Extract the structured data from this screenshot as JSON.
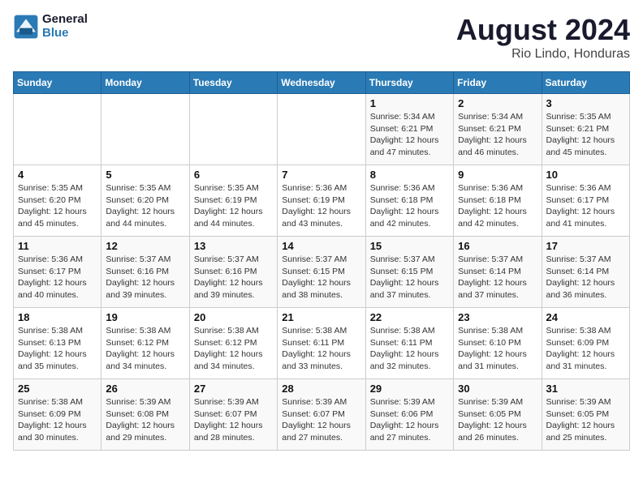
{
  "logo": {
    "text_general": "General",
    "text_blue": "Blue"
  },
  "header": {
    "title": "August 2024",
    "subtitle": "Rio Lindo, Honduras"
  },
  "weekdays": [
    "Sunday",
    "Monday",
    "Tuesday",
    "Wednesday",
    "Thursday",
    "Friday",
    "Saturday"
  ],
  "weeks": [
    [
      {
        "day": "",
        "info": ""
      },
      {
        "day": "",
        "info": ""
      },
      {
        "day": "",
        "info": ""
      },
      {
        "day": "",
        "info": ""
      },
      {
        "day": "1",
        "info": "Sunrise: 5:34 AM\nSunset: 6:21 PM\nDaylight: 12 hours\nand 47 minutes."
      },
      {
        "day": "2",
        "info": "Sunrise: 5:34 AM\nSunset: 6:21 PM\nDaylight: 12 hours\nand 46 minutes."
      },
      {
        "day": "3",
        "info": "Sunrise: 5:35 AM\nSunset: 6:21 PM\nDaylight: 12 hours\nand 45 minutes."
      }
    ],
    [
      {
        "day": "4",
        "info": "Sunrise: 5:35 AM\nSunset: 6:20 PM\nDaylight: 12 hours\nand 45 minutes."
      },
      {
        "day": "5",
        "info": "Sunrise: 5:35 AM\nSunset: 6:20 PM\nDaylight: 12 hours\nand 44 minutes."
      },
      {
        "day": "6",
        "info": "Sunrise: 5:35 AM\nSunset: 6:19 PM\nDaylight: 12 hours\nand 44 minutes."
      },
      {
        "day": "7",
        "info": "Sunrise: 5:36 AM\nSunset: 6:19 PM\nDaylight: 12 hours\nand 43 minutes."
      },
      {
        "day": "8",
        "info": "Sunrise: 5:36 AM\nSunset: 6:18 PM\nDaylight: 12 hours\nand 42 minutes."
      },
      {
        "day": "9",
        "info": "Sunrise: 5:36 AM\nSunset: 6:18 PM\nDaylight: 12 hours\nand 42 minutes."
      },
      {
        "day": "10",
        "info": "Sunrise: 5:36 AM\nSunset: 6:17 PM\nDaylight: 12 hours\nand 41 minutes."
      }
    ],
    [
      {
        "day": "11",
        "info": "Sunrise: 5:36 AM\nSunset: 6:17 PM\nDaylight: 12 hours\nand 40 minutes."
      },
      {
        "day": "12",
        "info": "Sunrise: 5:37 AM\nSunset: 6:16 PM\nDaylight: 12 hours\nand 39 minutes."
      },
      {
        "day": "13",
        "info": "Sunrise: 5:37 AM\nSunset: 6:16 PM\nDaylight: 12 hours\nand 39 minutes."
      },
      {
        "day": "14",
        "info": "Sunrise: 5:37 AM\nSunset: 6:15 PM\nDaylight: 12 hours\nand 38 minutes."
      },
      {
        "day": "15",
        "info": "Sunrise: 5:37 AM\nSunset: 6:15 PM\nDaylight: 12 hours\nand 37 minutes."
      },
      {
        "day": "16",
        "info": "Sunrise: 5:37 AM\nSunset: 6:14 PM\nDaylight: 12 hours\nand 37 minutes."
      },
      {
        "day": "17",
        "info": "Sunrise: 5:37 AM\nSunset: 6:14 PM\nDaylight: 12 hours\nand 36 minutes."
      }
    ],
    [
      {
        "day": "18",
        "info": "Sunrise: 5:38 AM\nSunset: 6:13 PM\nDaylight: 12 hours\nand 35 minutes."
      },
      {
        "day": "19",
        "info": "Sunrise: 5:38 AM\nSunset: 6:12 PM\nDaylight: 12 hours\nand 34 minutes."
      },
      {
        "day": "20",
        "info": "Sunrise: 5:38 AM\nSunset: 6:12 PM\nDaylight: 12 hours\nand 34 minutes."
      },
      {
        "day": "21",
        "info": "Sunrise: 5:38 AM\nSunset: 6:11 PM\nDaylight: 12 hours\nand 33 minutes."
      },
      {
        "day": "22",
        "info": "Sunrise: 5:38 AM\nSunset: 6:11 PM\nDaylight: 12 hours\nand 32 minutes."
      },
      {
        "day": "23",
        "info": "Sunrise: 5:38 AM\nSunset: 6:10 PM\nDaylight: 12 hours\nand 31 minutes."
      },
      {
        "day": "24",
        "info": "Sunrise: 5:38 AM\nSunset: 6:09 PM\nDaylight: 12 hours\nand 31 minutes."
      }
    ],
    [
      {
        "day": "25",
        "info": "Sunrise: 5:38 AM\nSunset: 6:09 PM\nDaylight: 12 hours\nand 30 minutes."
      },
      {
        "day": "26",
        "info": "Sunrise: 5:39 AM\nSunset: 6:08 PM\nDaylight: 12 hours\nand 29 minutes."
      },
      {
        "day": "27",
        "info": "Sunrise: 5:39 AM\nSunset: 6:07 PM\nDaylight: 12 hours\nand 28 minutes."
      },
      {
        "day": "28",
        "info": "Sunrise: 5:39 AM\nSunset: 6:07 PM\nDaylight: 12 hours\nand 27 minutes."
      },
      {
        "day": "29",
        "info": "Sunrise: 5:39 AM\nSunset: 6:06 PM\nDaylight: 12 hours\nand 27 minutes."
      },
      {
        "day": "30",
        "info": "Sunrise: 5:39 AM\nSunset: 6:05 PM\nDaylight: 12 hours\nand 26 minutes."
      },
      {
        "day": "31",
        "info": "Sunrise: 5:39 AM\nSunset: 6:05 PM\nDaylight: 12 hours\nand 25 minutes."
      }
    ]
  ]
}
